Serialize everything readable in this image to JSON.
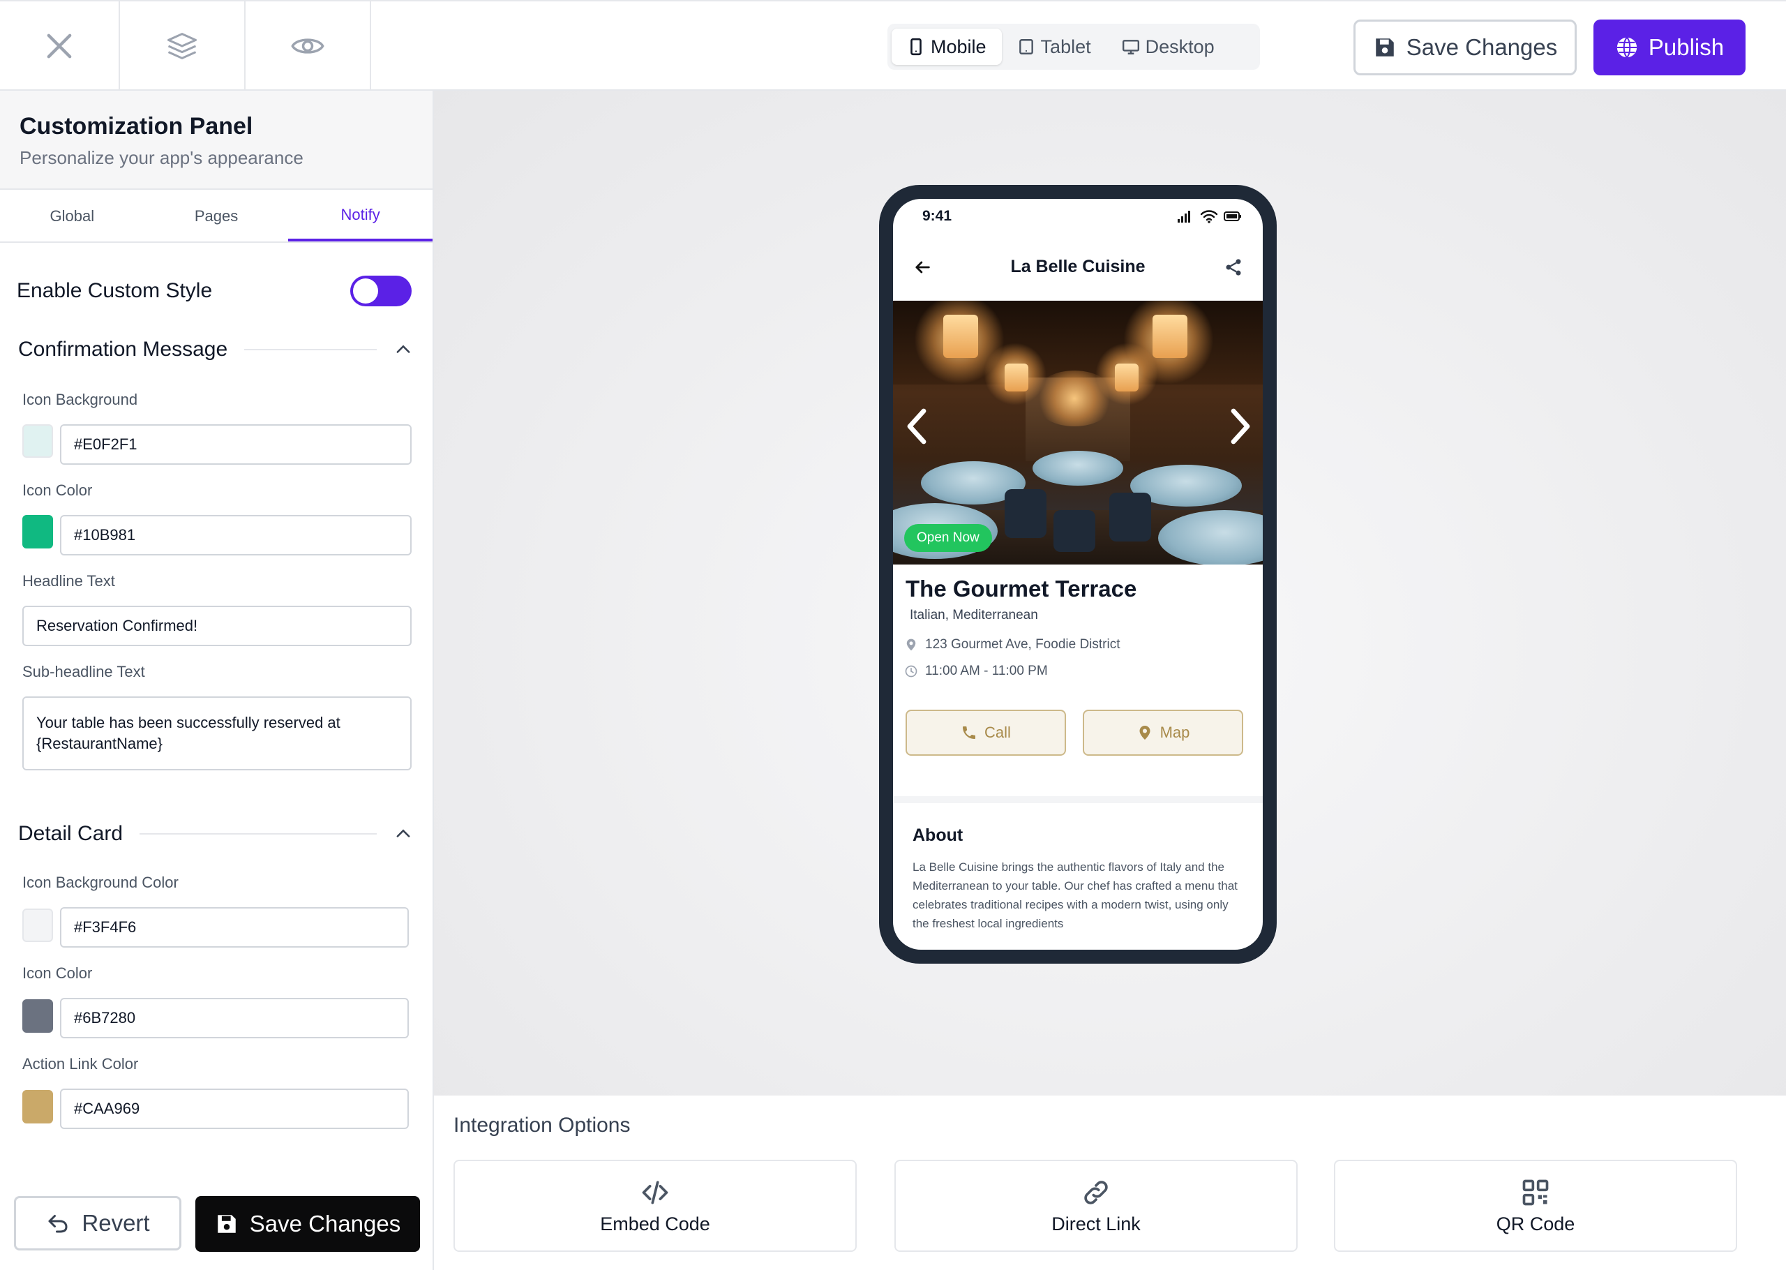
{
  "topbar": {
    "devices": [
      {
        "label": "Mobile",
        "icon": "mobile-icon",
        "active": true
      },
      {
        "label": "Tablet",
        "icon": "tablet-icon",
        "active": false
      },
      {
        "label": "Desktop",
        "icon": "desktop-icon",
        "active": false
      }
    ],
    "save_label": "Save Changes",
    "publish_label": "Publish",
    "accent": "#5B21E6"
  },
  "panel": {
    "title": "Customization Panel",
    "subtitle": "Personalize your app's appearance",
    "tabs": [
      {
        "label": "Global",
        "active": false
      },
      {
        "label": "Pages",
        "active": false
      },
      {
        "label": "Notify",
        "active": true
      }
    ],
    "enable_custom_style": {
      "label": "Enable Custom Style",
      "on": true
    },
    "confirmation": {
      "title": "Confirmation Message",
      "icon_bg_label": "Icon Background",
      "icon_bg_value": "#E0F2F1",
      "icon_color_label": "Icon Color",
      "icon_color_value": "#10B981",
      "headline_label": "Headline Text",
      "headline_value": "Reservation Confirmed!",
      "subheadline_label": "Sub-headline Text",
      "subheadline_value": "Your table has been successfully reserved at {RestaurantName}"
    },
    "detail_card": {
      "title": "Detail Card",
      "icon_bg_label": "Icon Background Color",
      "icon_bg_value": "#F3F4F6",
      "icon_color_label": "Icon Color",
      "icon_color_value": "#6B7280",
      "action_link_label": "Action Link Color",
      "action_link_value": "#CAA969"
    },
    "revert_label": "Revert",
    "save_label": "Save Changes"
  },
  "phone": {
    "time": "9:41",
    "app_title": "La Belle Cuisine",
    "badge": "Open Now",
    "name": "The Gourmet Terrace",
    "cuisine": "Italian, Mediterranean",
    "address": "123 Gourmet Ave, Foodie District",
    "hours": "11:00 AM - 11:00 PM",
    "call_label": "Call",
    "map_label": "Map",
    "about_title": "About",
    "about_text": "La Belle Cuisine brings the authentic flavors of Italy and the Mediterranean to your table. Our chef has crafted a menu that celebrates traditional recipes with a modern twist, using only the freshest local ingredients"
  },
  "integration": {
    "title": "Integration Options",
    "cards": [
      {
        "label": "Embed Code",
        "icon": "code-icon"
      },
      {
        "label": "Direct Link",
        "icon": "link-icon"
      },
      {
        "label": "QR Code",
        "icon": "qr-code-icon"
      }
    ]
  }
}
